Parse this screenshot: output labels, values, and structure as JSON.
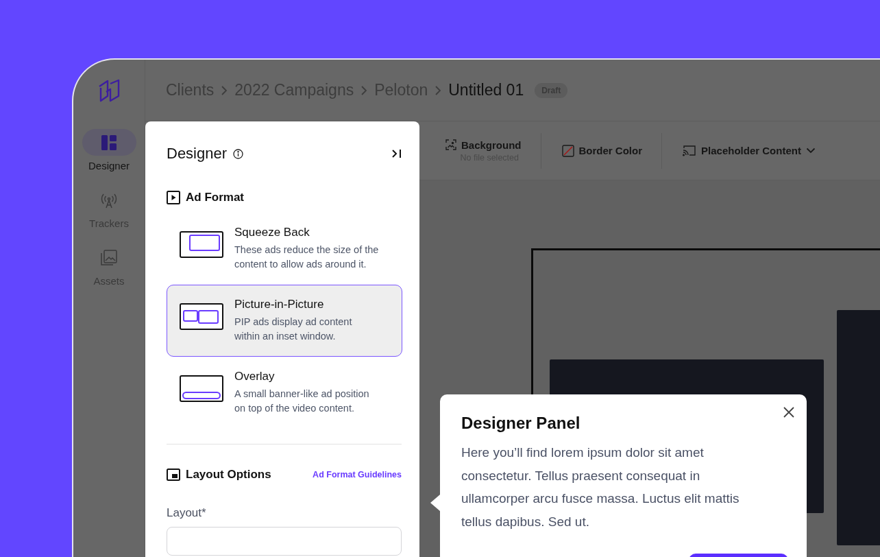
{
  "rail": {
    "items": [
      {
        "kind": "designer",
        "label": "Designer",
        "selected": true
      },
      {
        "kind": "trackers",
        "label": "Trackers",
        "selected": false
      },
      {
        "kind": "assets",
        "label": "Assets",
        "selected": false
      }
    ]
  },
  "breadcrumbs": [
    {
      "label": "Clients",
      "current": false
    },
    {
      "label": "2022 Campaigns",
      "current": false
    },
    {
      "label": "Peloton",
      "current": false
    },
    {
      "label": "Untitled 01",
      "current": true
    }
  ],
  "status_badge": "Draft",
  "toolbar": [
    {
      "kind": "background",
      "label": "Background",
      "subtitle": "No file selected"
    },
    {
      "kind": "border",
      "label": "Border Color"
    },
    {
      "kind": "placeholder",
      "label": "Placeholder Content"
    }
  ],
  "panel": {
    "title": "Designer",
    "ad_format": {
      "heading": "Ad Format",
      "options": [
        {
          "kind": "squeeze",
          "title": "Squeeze Back",
          "description": "These ads reduce the size of the content to allow ads around it.",
          "selected": false
        },
        {
          "kind": "pip",
          "title": "Picture-in-Picture",
          "description": "PIP ads display ad content within an inset window.",
          "selected": true
        },
        {
          "kind": "overlay",
          "title": "Overlay",
          "description": "A small banner-like ad position on top of the video content.",
          "selected": false
        }
      ]
    },
    "layout_options": {
      "heading": "Layout Options",
      "link": "Ad Format Guidelines",
      "field_label": "Layout*"
    }
  },
  "tooltip": {
    "title": "Designer Panel",
    "body": "Here you’ll find lorem ipsum dolor sit amet consectetur. Tellus praesent consequat in ullamcorper arcu fusce massa. Luctus elit mattis tellus dapibus. Sed ut."
  }
}
